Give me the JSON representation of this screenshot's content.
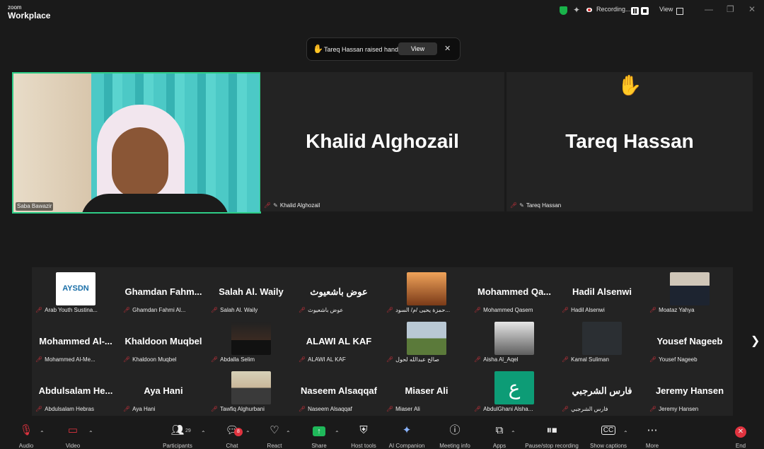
{
  "app": {
    "logo_line1": "zoom",
    "logo_line2": "Workplace",
    "recording": "Recording...",
    "view": "View"
  },
  "notification": {
    "text": "Tareq Hassan raised hand",
    "view_label": "View",
    "close": "✕"
  },
  "main": {
    "speaker": {
      "name": "Saba Bawazir"
    },
    "tile2": {
      "big_name": "Khalid Alghozail",
      "label": "Khalid Alghozail"
    },
    "tile3": {
      "big_name": "Tareq Hassan",
      "label": "Tareq Hassan",
      "raised_hand": "✋"
    }
  },
  "gallery": [
    {
      "name": "",
      "label": "Arab Youth Sustina...",
      "avatar": "aysdn",
      "avatar_text": "AYSDN"
    },
    {
      "name": "Ghamdan  Fahm...",
      "label": "Ghamdan Fahmi Al..."
    },
    {
      "name": "Salah Al. Waily",
      "label": "Salah Al. Waily"
    },
    {
      "name": "عوض باشعيوث",
      "label": "عوض باشعيوث"
    },
    {
      "name": "",
      "label": "حمزة يحيى /م/ السود...",
      "avatar": "sunset"
    },
    {
      "name": "Mohammed  Qa...",
      "label": "Mohammed Qasem"
    },
    {
      "name": "Hadil Alsenwi",
      "label": "Hadil Alsenwi"
    },
    {
      "name": "",
      "label": "Moataz Yahya",
      "avatar": "suit"
    },
    {
      "name": "Mohammed  Al-...",
      "label": "Mohammed Al-Me..."
    },
    {
      "name": "Khaldoon Muqbel",
      "label": "Khaldoon Muqbel"
    },
    {
      "name": "",
      "label": "Abdalla Selim",
      "avatar": "dark"
    },
    {
      "name": "ALAWI AL KAF",
      "label": "ALAWI AL KAF"
    },
    {
      "name": "",
      "label": "صالح عبدالله لحول",
      "avatar": "field"
    },
    {
      "name": "",
      "label": "Aisha Al_Aqel",
      "avatar": "bw"
    },
    {
      "name": "",
      "label": "Kamal Suliman",
      "avatar": "logo"
    },
    {
      "name": "Yousef Nageeb",
      "label": "Yousef Nageeb"
    },
    {
      "name": "Abdulsalam  He...",
      "label": "Abdulsalam Hebras"
    },
    {
      "name": "Aya Hani",
      "label": "Aya Hani"
    },
    {
      "name": "",
      "label": "Tawfiq Alghurbani",
      "avatar": "man"
    },
    {
      "name": "Naseem Alsaqqaf",
      "label": "Naseem Alsaqqaf"
    },
    {
      "name": "Miaser Ali",
      "label": "Miaser Ali"
    },
    {
      "name": "",
      "label": "AbdulGhani Alsha...",
      "avatar": "letter",
      "avatar_text": "ع"
    },
    {
      "name": "فارس الشرجبي",
      "label": "فارس الشرجبي"
    },
    {
      "name": "Jeremy Hansen",
      "label": "Jeremy Hansen"
    }
  ],
  "toolbar": {
    "audio": "Audio",
    "video": "Video",
    "participants": "Participants",
    "participants_count": "29",
    "chat": "Chat",
    "chat_badge": "8",
    "react": "React",
    "share": "Share",
    "host_tools": "Host tools",
    "ai_companion": "AI Companion",
    "meeting_info": "Meeting info",
    "apps": "Apps",
    "pause_stop": "Pause/stop recording",
    "captions": "Show captions",
    "more": "More",
    "end": "End"
  },
  "colors": {
    "accent_green": "#2ecc87",
    "end_red": "#e0333f",
    "share_green": "#1fb85a"
  }
}
